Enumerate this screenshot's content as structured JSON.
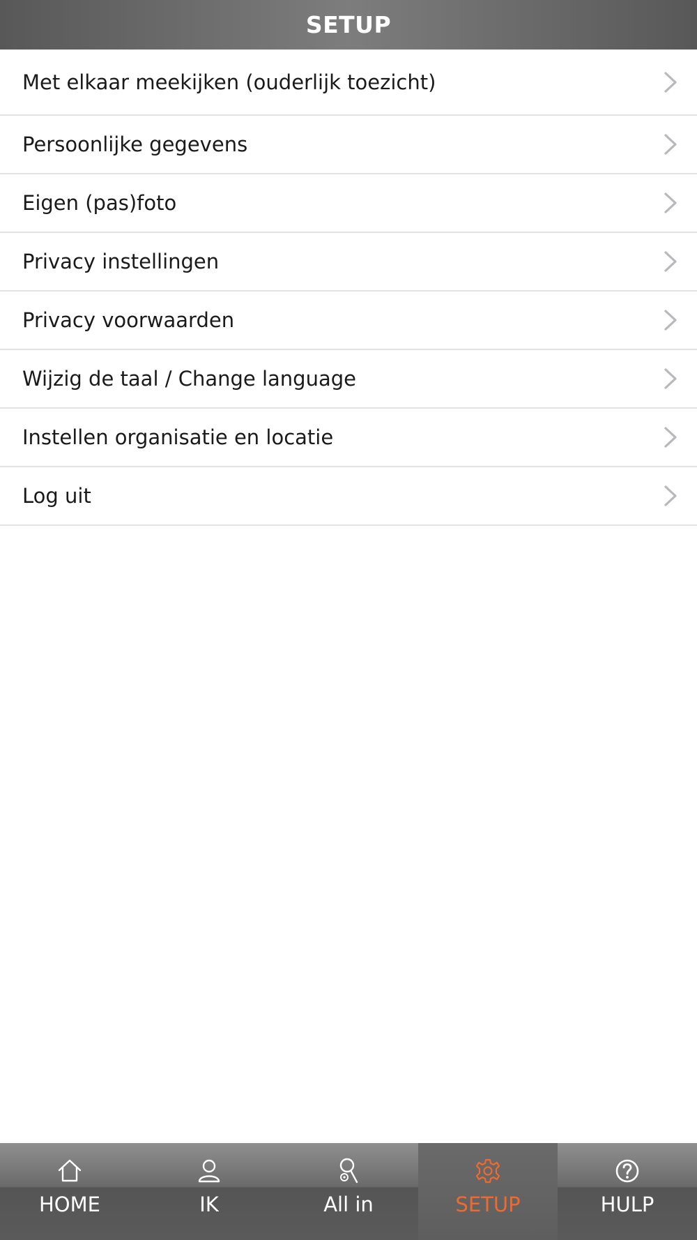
{
  "header": {
    "title": "SETUP"
  },
  "menu": {
    "items": [
      {
        "label": "Met elkaar meekijken (ouderlijk toezicht)"
      },
      {
        "label": "Persoonlijke gegevens"
      },
      {
        "label": "Eigen (pas)foto"
      },
      {
        "label": "Privacy instellingen"
      },
      {
        "label": "Privacy voorwaarden"
      },
      {
        "label": "Wijzig de taal / Change language"
      },
      {
        "label": "Instellen organisatie en locatie"
      },
      {
        "label": "Log uit"
      }
    ],
    "chevron_icon": "chevron-right-icon",
    "chevron_color": "#b8b8bc"
  },
  "tabbar": {
    "active_color": "#ee6a2f",
    "tabs": [
      {
        "label": "HOME",
        "icon": "home-icon"
      },
      {
        "label": "IK",
        "icon": "user-icon"
      },
      {
        "label": "All in",
        "icon": "search-people-icon"
      },
      {
        "label": "SETUP",
        "icon": "gear-icon",
        "active": true
      },
      {
        "label": "HULP",
        "icon": "help-icon"
      }
    ]
  }
}
